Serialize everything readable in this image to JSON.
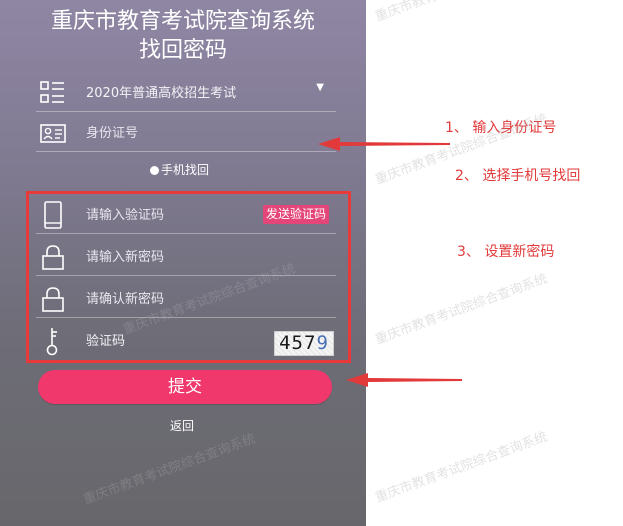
{
  "titles": {
    "line1": "重庆市教育考试院查询系统",
    "line2": "找回密码"
  },
  "form": {
    "exam_select": "2020年普通高校招生考试",
    "id_placeholder": "身份证号",
    "radio_label": "手机找回",
    "code_placeholder": "请输入验证码",
    "send_code_label": "发送验证码",
    "new_pwd_placeholder": "请输入新密码",
    "confirm_pwd_placeholder": "请确认新密码",
    "captcha_label": "验证码",
    "captcha_chars": "457",
    "captcha_last": "9",
    "submit_label": "提交",
    "back_label": "返回"
  },
  "annotations": {
    "step1": "1、 输入身份证号",
    "step2": "2、 选择手机号找回",
    "step3": "3、 设置新密码"
  },
  "watermark": "重庆市教育考试院综合查询系统",
  "colors": {
    "accent": "#f0386c",
    "annotation_red": "#e23a3a",
    "panel_top": "#8f86a4",
    "panel_bottom": "#67676b"
  },
  "icons": {
    "exam": "list-icon",
    "id": "id-card-icon",
    "phone": "tablet-icon",
    "pwd": "lock-icon",
    "key": "key-icon"
  }
}
